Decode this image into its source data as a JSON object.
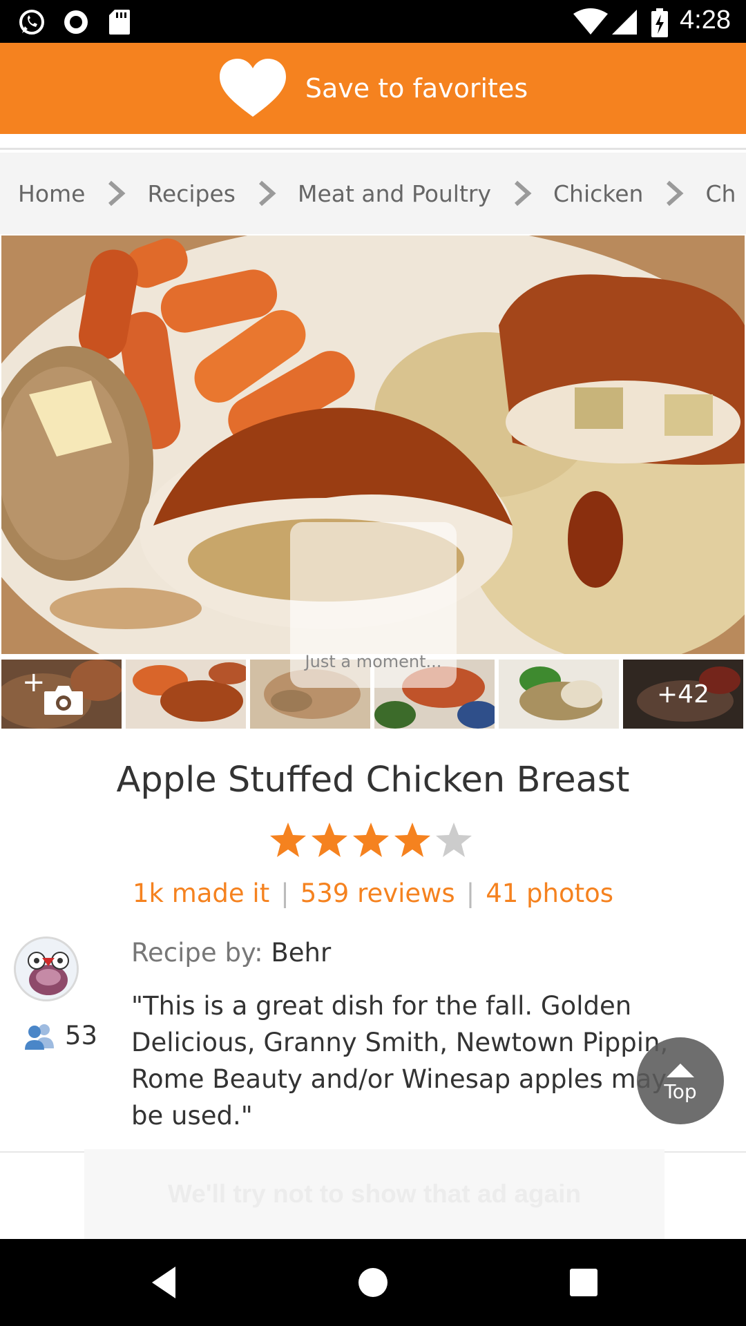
{
  "status_bar": {
    "time": "4:28",
    "icons": [
      "whatsapp-icon",
      "record-icon",
      "sd-card-icon",
      "wifi-icon",
      "signal-icon",
      "battery-charging-icon"
    ]
  },
  "favorites_bar": {
    "label": "Save to favorites",
    "icon": "heart-icon",
    "background_color": "#f5821f"
  },
  "breadcrumb": {
    "items": [
      "Home",
      "Recipes",
      "Meat and Poultry",
      "Chicken",
      "Ch"
    ]
  },
  "gallery": {
    "loading_text": "Just a moment...",
    "more_count": "+42",
    "add_photo_icon": "camera-plus-icon"
  },
  "recipe": {
    "title": "Apple Stuffed Chicken Breast",
    "rating": 4,
    "rating_max": 5,
    "made_it": "1k made it",
    "reviews": "539 reviews",
    "photos": "41 photos",
    "byline_label": "Recipe by:",
    "author": "Behr",
    "followers": "53",
    "description": "\"This is a great dish for the fall. Golden Delicious, Granny Smith, Newtown Pippin, Rome Beauty and/or Winesap apples may be used.\""
  },
  "top_button": {
    "label": "Top"
  },
  "ad_notice": {
    "text": "We'll try not to show that ad again"
  },
  "colors": {
    "accent": "#f5821f",
    "star_empty": "#cccccc"
  }
}
